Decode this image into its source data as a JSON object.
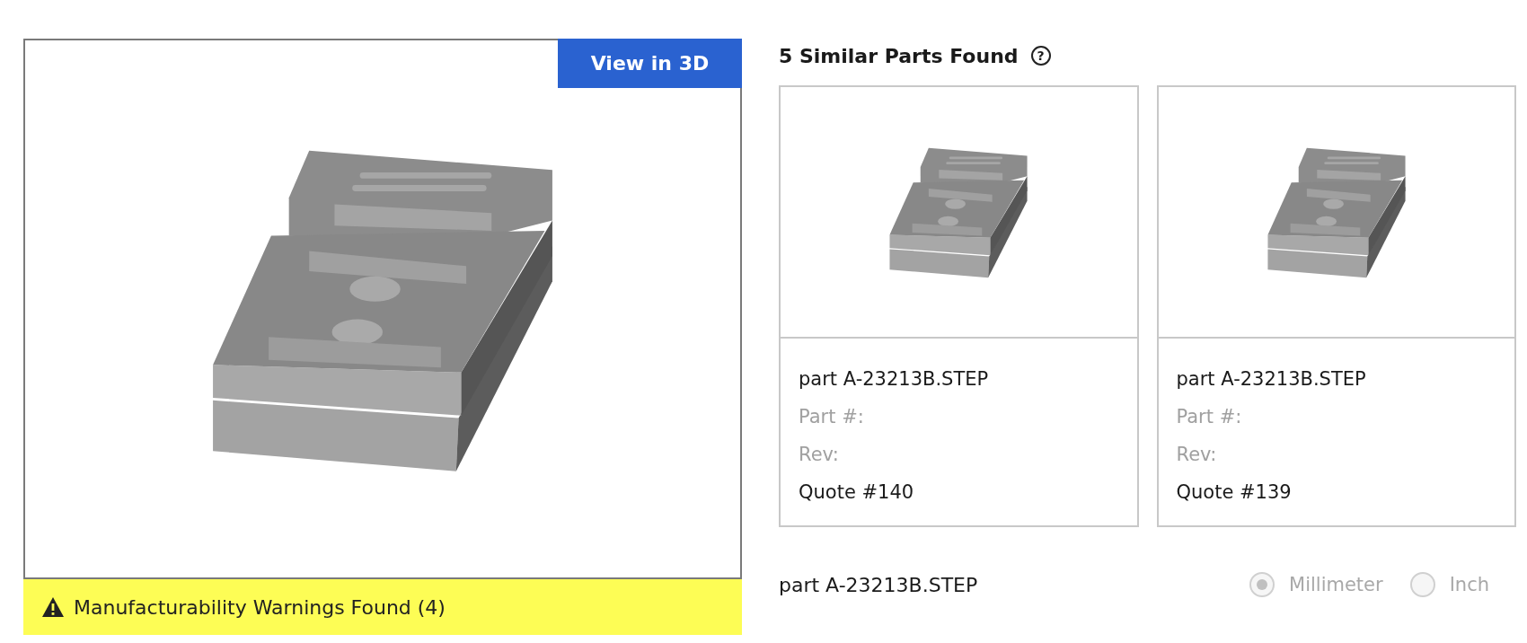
{
  "viewer": {
    "view_button": "View in 3D",
    "warning": "Manufacturability Warnings Found (4)"
  },
  "similar_parts": {
    "heading": "5 Similar Parts Found",
    "help_icon": "?",
    "cards": [
      {
        "name": "part A-23213B.STEP",
        "part_number": "Part #:",
        "rev": "Rev:",
        "quote": "Quote #140"
      },
      {
        "name": "part A-23213B.STEP",
        "part_number": "Part #:",
        "rev": "Rev:",
        "quote": "Quote #139"
      }
    ]
  },
  "file": {
    "name": "part A-23213B.STEP",
    "units": [
      {
        "label": "Millimeter",
        "selected": true,
        "disabled": true
      },
      {
        "label": "Inch",
        "selected": false,
        "disabled": true
      }
    ]
  }
}
